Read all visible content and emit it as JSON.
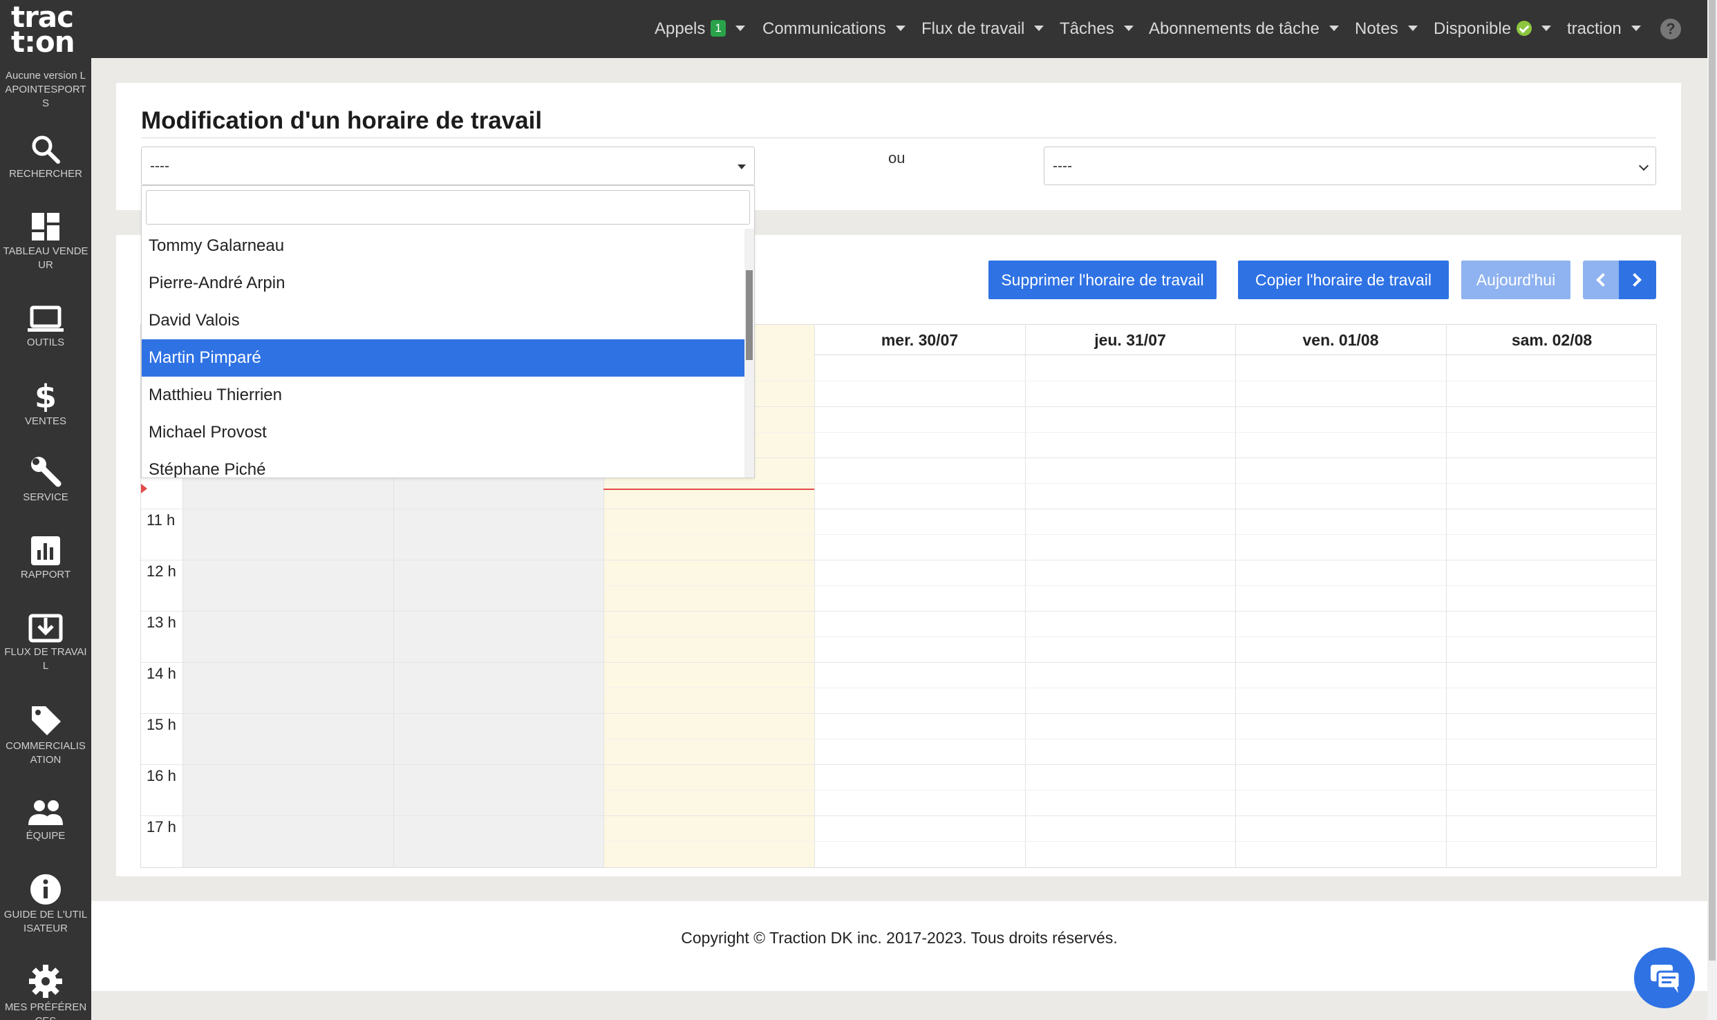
{
  "sidebar": {
    "logo_line1": "trac",
    "logo_line2": "t:on",
    "version": "Aucune version LAPOINTESPORTS",
    "items": [
      {
        "label": "RECHERCHER",
        "icon": "search-icon"
      },
      {
        "label": "TABLEAU VENDEUR",
        "icon": "dashboard-icon"
      },
      {
        "label": "OUTILS",
        "icon": "laptop-icon"
      },
      {
        "label": "VENTES",
        "icon": "dollar-icon"
      },
      {
        "label": "SERVICE",
        "icon": "wrench-icon"
      },
      {
        "label": "RAPPORT",
        "icon": "bar-chart-icon"
      },
      {
        "label": "FLUX DE TRAVAIL",
        "icon": "download-box-icon"
      },
      {
        "label": "COMMERCIALISATION",
        "icon": "tag-icon"
      },
      {
        "label": "ÉQUIPE",
        "icon": "people-icon"
      },
      {
        "label": "GUIDE DE L'UTILISATEUR",
        "icon": "info-icon"
      },
      {
        "label": "MES PRÉFÉRENCES",
        "icon": "gear-icon"
      }
    ]
  },
  "topnav": {
    "appels": "Appels",
    "appels_badge": "1",
    "communications": "Communications",
    "flux": "Flux de travail",
    "taches": "Tâches",
    "abonnements": "Abonnements de tâche",
    "notes": "Notes",
    "disponible": "Disponible",
    "user": "traction",
    "help": "?"
  },
  "page": {
    "title": "Modification d'un horaire de travail",
    "select1_value": "----",
    "or_label": "ou",
    "select2_value": "----"
  },
  "dropdown": {
    "options": [
      "Tommy Galarneau",
      "Pierre-André Arpin",
      "David Valois",
      "Martin Pimparé",
      "Matthieu Thierrien",
      "Michael Provost",
      "Stéphane Piché"
    ],
    "selected": "Martin Pimparé"
  },
  "toolbar": {
    "delete_label": "Supprimer l'horaire de travail",
    "copy_label": "Copier l'horaire de travail",
    "today_label": "Aujourd'hui"
  },
  "calendar": {
    "days": [
      "",
      "",
      "",
      "mer. 30/07",
      "jeu. 31/07",
      "ven. 01/08",
      "sam. 02/08"
    ],
    "hours": [
      "11 h",
      "12 h",
      "13 h",
      "14 h",
      "15 h",
      "16 h",
      "17 h"
    ]
  },
  "footer": {
    "copyright": "Copyright © Traction DK inc. 2017-2023. Tous droits réservés."
  },
  "colors": {
    "primary": "#2f72e4",
    "primary_disabled": "#8fb3f0",
    "dark_bar": "#343434",
    "today_bg": "#fdf8e3",
    "past_bg": "#f0f0f0",
    "badge_green": "#2aa24a",
    "available_green": "#8cc63f"
  }
}
